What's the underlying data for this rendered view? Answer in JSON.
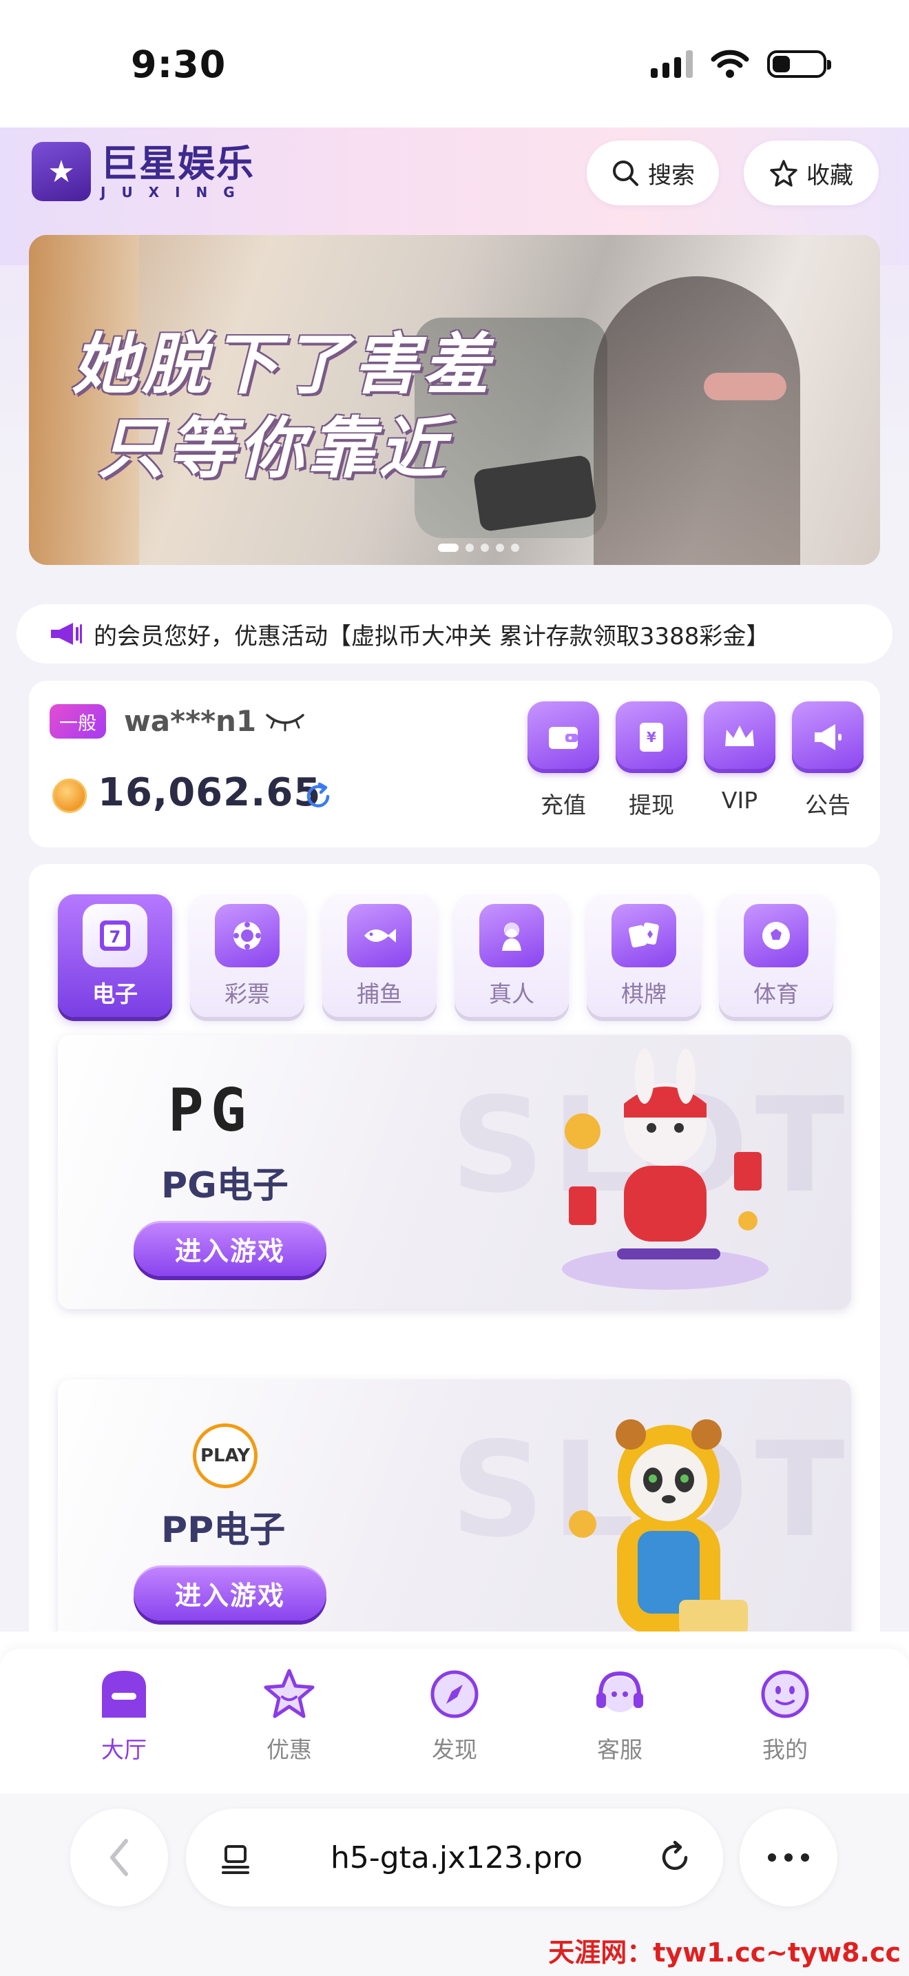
{
  "status_bar": {
    "time": "9:30"
  },
  "header": {
    "logo_cn": "巨星娱乐",
    "logo_en": "JUXING",
    "search_label": "搜索",
    "favorite_label": "收藏"
  },
  "banner": {
    "line1": "她脱下了害羞",
    "line2": "只等你靠近",
    "slide_count": 5,
    "active_slide": 1
  },
  "marquee": {
    "text": "的会员您好，优惠活动【虚拟币大冲关 累计存款领取3388彩金】"
  },
  "user": {
    "level": "一般",
    "username": "wa***n1",
    "balance": "16,062.65"
  },
  "actions": [
    {
      "label": "充值",
      "icon": "wallet-icon"
    },
    {
      "label": "提现",
      "icon": "yen-card-icon"
    },
    {
      "label": "VIP",
      "icon": "crown-icon"
    },
    {
      "label": "公告",
      "icon": "megaphone-icon"
    }
  ],
  "categories": [
    {
      "label": "电子",
      "icon": "slot-seven-icon",
      "active": true
    },
    {
      "label": "彩票",
      "icon": "lottery-ball-icon",
      "active": false
    },
    {
      "label": "捕鱼",
      "icon": "fish-icon",
      "active": false
    },
    {
      "label": "真人",
      "icon": "dealer-icon",
      "active": false
    },
    {
      "label": "棋牌",
      "icon": "cards-icon",
      "active": false
    },
    {
      "label": "体育",
      "icon": "soccer-ball-icon",
      "active": false
    }
  ],
  "games": [
    {
      "logo": "PG",
      "name": "PG电子",
      "button": "进入游戏",
      "bg_text": "SLOT"
    },
    {
      "logo": "PLAY",
      "name": "PP电子",
      "button": "进入游戏",
      "bg_text": "SLOT"
    }
  ],
  "bottom_nav": [
    {
      "label": "大厅",
      "icon": "lobby-icon",
      "active": true
    },
    {
      "label": "优惠",
      "icon": "star-icon",
      "active": false
    },
    {
      "label": "发现",
      "icon": "compass-icon",
      "active": false
    },
    {
      "label": "客服",
      "icon": "headset-icon",
      "active": false
    },
    {
      "label": "我的",
      "icon": "smiley-icon",
      "active": false
    }
  ],
  "browser": {
    "url": "h5-gta.jx123.pro"
  },
  "watermark": "天涯网：tyw1.cc~tyw8.cc",
  "colors": {
    "accent": "#8a3ce6",
    "nav_inactive": "#888888"
  }
}
